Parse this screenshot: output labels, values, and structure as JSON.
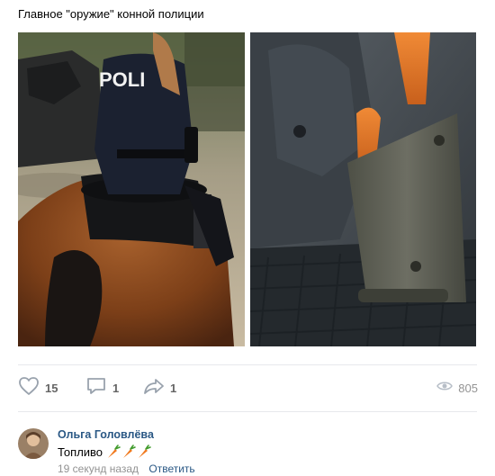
{
  "post": {
    "text": "Главное \"оружие\" конной полиции",
    "photos": [
      {
        "name": "mounted-officer-photo",
        "printed_text": "POLI"
      },
      {
        "name": "holster-carrot-photo"
      }
    ]
  },
  "actions": {
    "likes": "15",
    "comments": "1",
    "shares": "1",
    "views": "805",
    "icons": {
      "like": "heart-icon",
      "comment": "comment-icon",
      "share": "share-icon",
      "views": "eye-icon"
    }
  },
  "comment": {
    "author": "Ольга Головлёва",
    "text": "Топливо",
    "emoji": [
      "carrot-emoji",
      "carrot-emoji",
      "carrot-emoji"
    ],
    "time": "19 секунд назад",
    "reply_label": "Ответить"
  },
  "colors": {
    "link": "#2a5885",
    "muted": "#939393",
    "divider": "#e7e8ec",
    "icon": "#99a2ad"
  }
}
